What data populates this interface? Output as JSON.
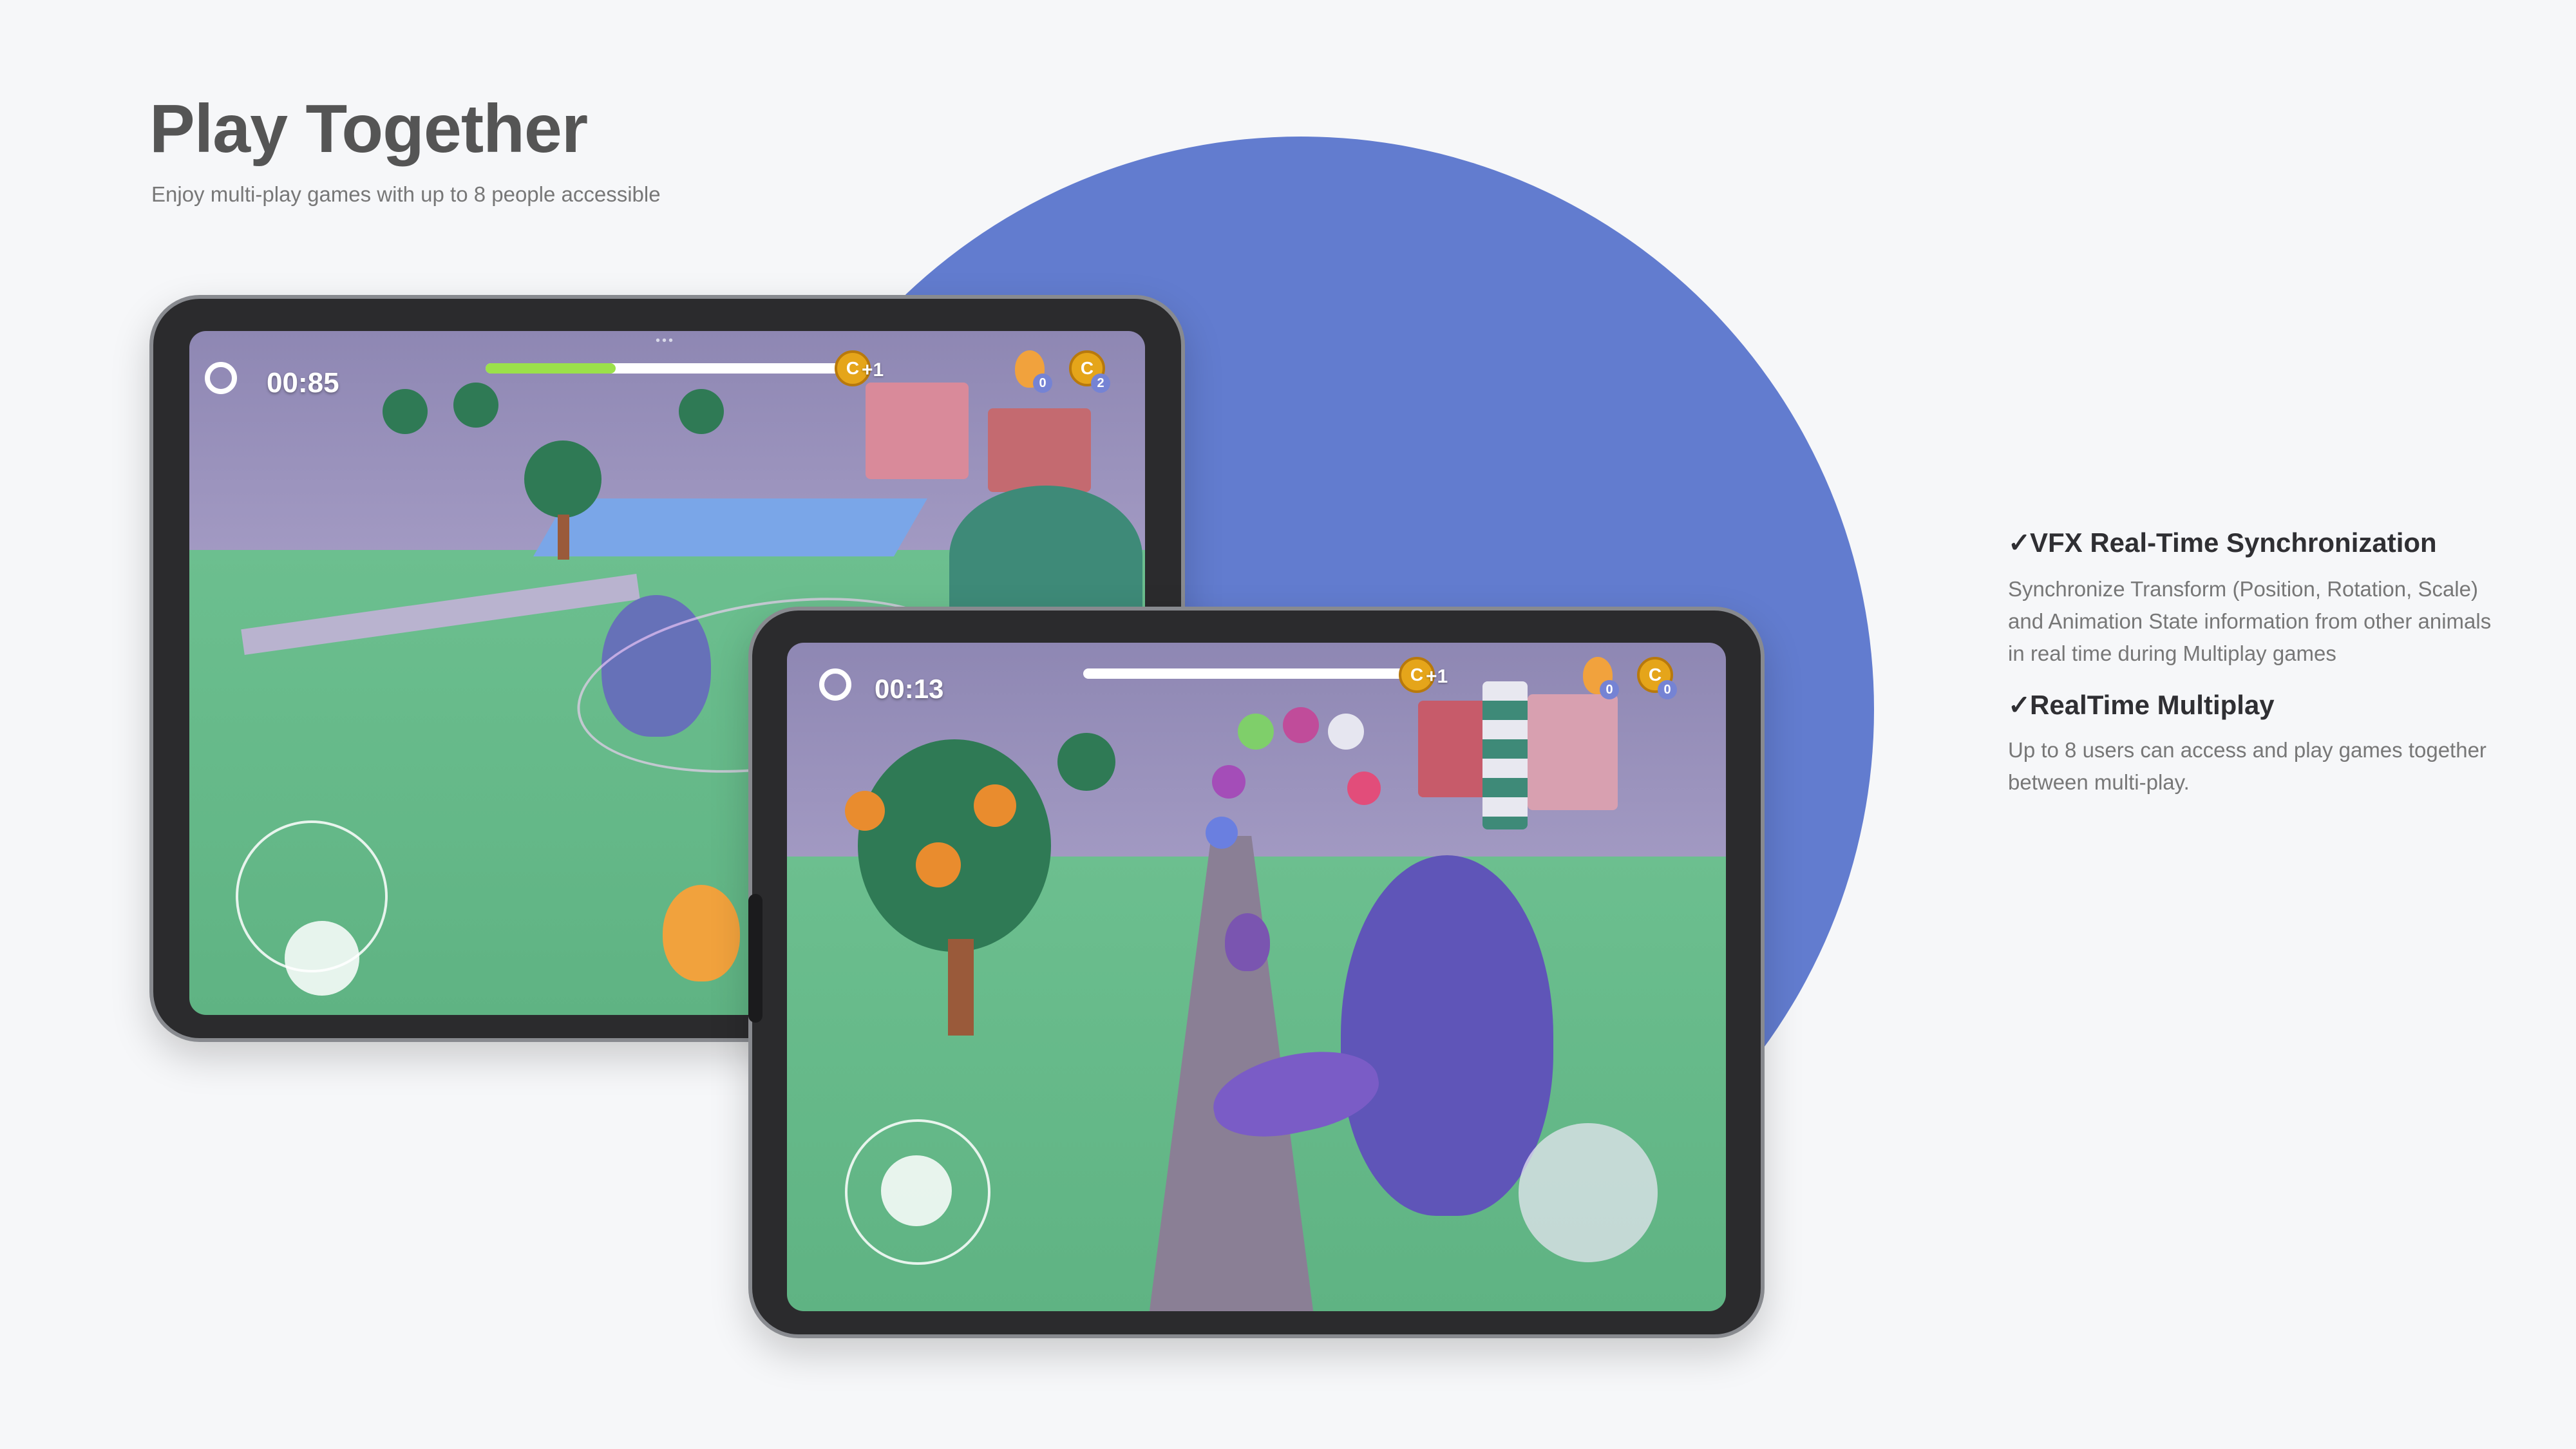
{
  "header": {
    "title": "Play Together",
    "subtitle": "Enjoy multi-play games with up to 8 people accessible"
  },
  "colors": {
    "accent_circle": "#627ccf",
    "progress_green": "#9be14a",
    "coin_gold": "#e5a51a"
  },
  "tablets": {
    "back": {
      "timer": "00:85",
      "progress_fraction": 0.36,
      "coin_plus": "+1",
      "egg_count": "0",
      "coin_count": "2",
      "coin_letter": "C"
    },
    "front": {
      "timer": "00:13",
      "progress_fraction": 0,
      "coin_plus": "+1",
      "egg_count": "0",
      "coin_count": "0",
      "coin_letter": "C"
    }
  },
  "features": [
    {
      "check": "✓",
      "title": "VFX  Real-Time Synchronization",
      "desc_lines": [
        "Synchronize Transform (Position, Rotation, Scale)",
        "and Animation State information from other animals",
        "in real time during Multiplay games"
      ]
    },
    {
      "check": "✓",
      "title": "RealTime Multiplay",
      "desc_lines": [
        "Up to 8 users can access and play games together",
        "between multi-play."
      ]
    }
  ],
  "icons": {
    "timer": "stopwatch-icon",
    "coin": "coin-icon",
    "egg": "egg-icon",
    "check": "check-icon"
  }
}
